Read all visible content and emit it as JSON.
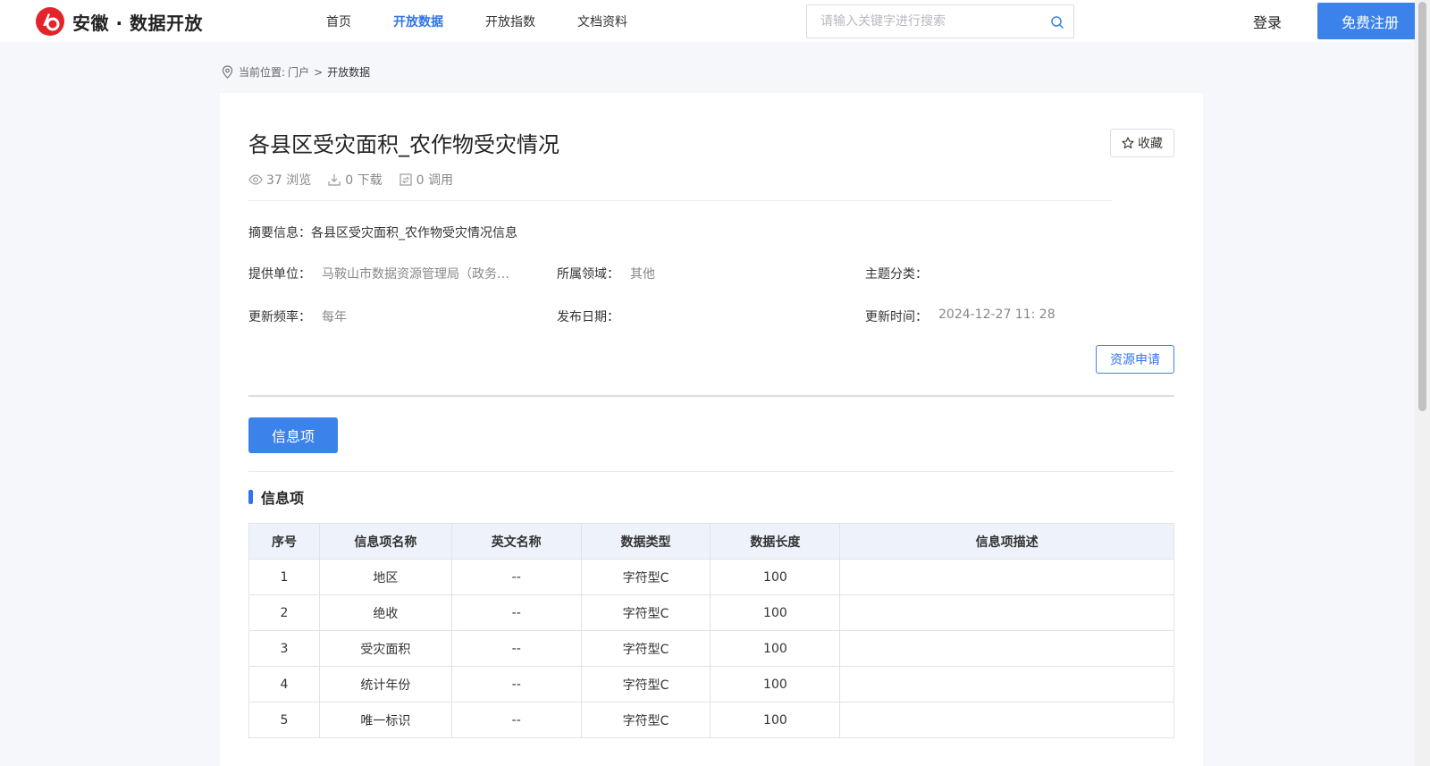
{
  "header": {
    "logo_text": "安徽 · 数据开放",
    "nav": [
      {
        "label": "首页",
        "active": false
      },
      {
        "label": "开放数据",
        "active": true
      },
      {
        "label": "开放指数",
        "active": false
      },
      {
        "label": "文档资料",
        "active": false
      }
    ],
    "search_placeholder": "请输入关键字进行搜索",
    "login_label": "登录",
    "register_label": "免费注册"
  },
  "breadcrumb": {
    "prefix": "当前位置:",
    "home": "门户",
    "separator": ">",
    "current": "开放数据"
  },
  "dataset": {
    "title": "各县区受灾面积_农作物受灾情况",
    "favorite_label": "收藏",
    "views": "37 浏览",
    "downloads": "0 下载",
    "calls": "0 调用",
    "summary": "摘要信息：各县区受灾面积_农作物受灾情况信息",
    "provider_label": "提供单位：",
    "provider_value": "马鞍山市数据资源管理局（政务服务管理局）",
    "domain_label": "所属领域：",
    "domain_value": "其他",
    "topic_label": "主题分类：",
    "topic_value": "",
    "frequency_label": "更新频率：",
    "frequency_value": "每年",
    "publish_label": "发布日期：",
    "publish_value": "",
    "updated_label": "更新时间：",
    "updated_value": "2024-12-27 11: 28",
    "apply_label": "资源申请"
  },
  "tab_label": "信息项",
  "section_title": "信息项",
  "table": {
    "headers": [
      "序号",
      "信息项名称",
      "英文名称",
      "数据类型",
      "数据长度",
      "信息项描述"
    ],
    "rows": [
      [
        "1",
        "地区",
        "--",
        "字符型C",
        "100",
        ""
      ],
      [
        "2",
        "绝收",
        "--",
        "字符型C",
        "100",
        ""
      ],
      [
        "3",
        "受灾面积",
        "--",
        "字符型C",
        "100",
        ""
      ],
      [
        "4",
        "统计年份",
        "--",
        "字符型C",
        "100",
        ""
      ],
      [
        "5",
        "唯一标识",
        "--",
        "字符型C",
        "100",
        ""
      ]
    ]
  },
  "colors": {
    "accent": "#3b82ea",
    "logo_red": "#e3242b"
  }
}
